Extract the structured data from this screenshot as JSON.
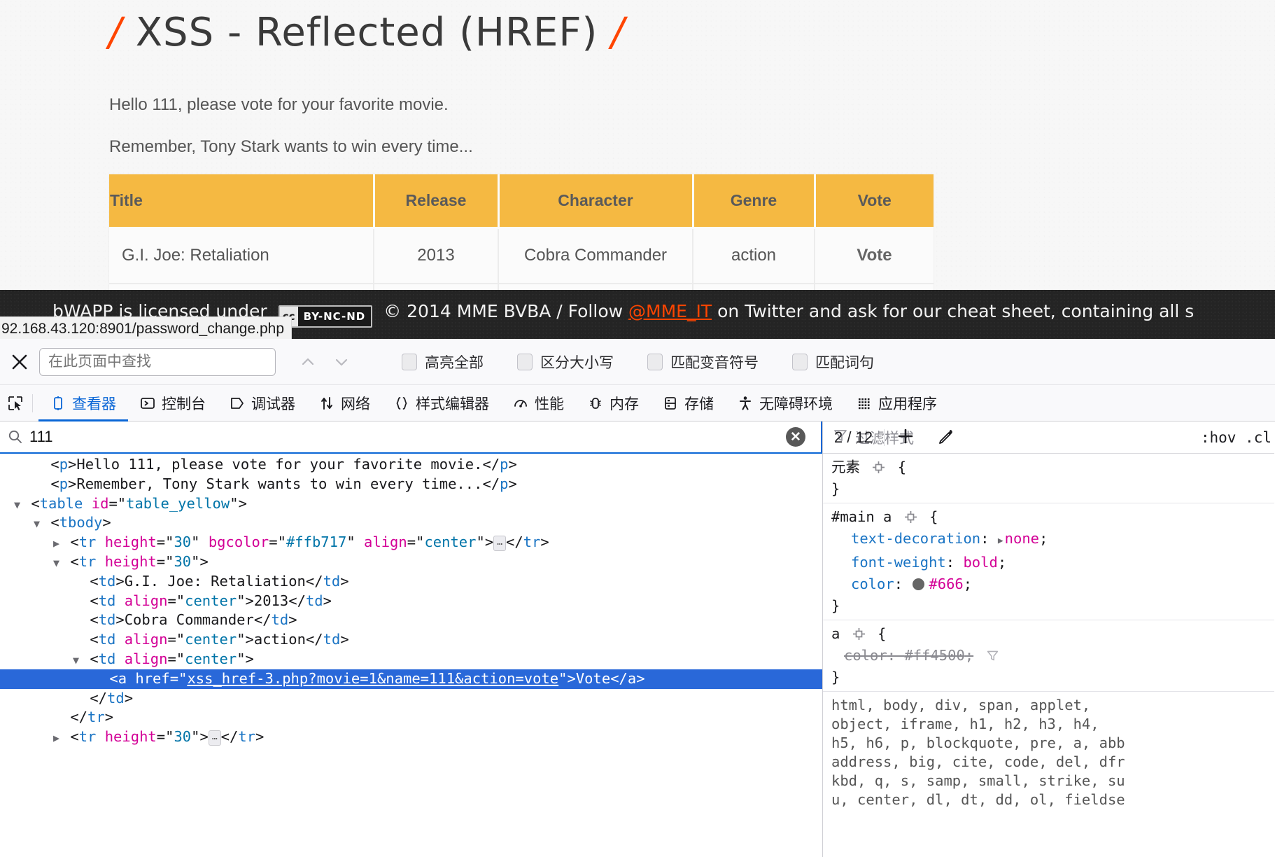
{
  "page": {
    "title_slash_left": "/",
    "title": "XSS - Reflected (HREF)",
    "title_slash_right": "/",
    "para_1": "Hello 111, please vote for your favorite movie.",
    "para_2": "Remember, Tony Stark wants to win every time...",
    "table": {
      "headers": [
        "Title",
        "Release",
        "Character",
        "Genre",
        "Vote"
      ],
      "rows": [
        {
          "title": "G.I. Joe: Retaliation",
          "release": "2013",
          "character": "Cobra Commander",
          "genre": "action",
          "vote": "Vote"
        }
      ]
    },
    "header_bg": "#f5b942"
  },
  "footer": {
    "text_before": "bWAPP is licensed under",
    "cc_mark": "cc",
    "cc_badge": "BY-NC-ND",
    "text_mid": "© 2014 MME BVBA / Follow",
    "twitter_handle": "@MME_IT",
    "text_after": "on Twitter and ask for our cheat sheet, containing all s",
    "link_color": "#ff4500"
  },
  "status_url": "92.168.43.120:8901/password_change.php",
  "find_bar": {
    "close_icon": "close-icon",
    "placeholder": "在此页面中查找",
    "value": "",
    "prev_icon": "chevron-up-icon",
    "next_icon": "chevron-down-icon",
    "checkboxes": [
      {
        "label": "高亮全部",
        "checked": false
      },
      {
        "label": "区分大小写",
        "checked": false
      },
      {
        "label": "匹配变音符号",
        "checked": false
      },
      {
        "label": "匹配词句",
        "checked": false
      }
    ]
  },
  "devtools": {
    "picker_icon": "element-picker-icon",
    "tabs": [
      {
        "label": "查看器",
        "icon": "inspector-icon",
        "active": true
      },
      {
        "label": "控制台",
        "icon": "console-icon",
        "active": false
      },
      {
        "label": "调试器",
        "icon": "debugger-icon",
        "active": false
      },
      {
        "label": "网络",
        "icon": "network-icon",
        "active": false
      },
      {
        "label": "样式编辑器",
        "icon": "style-editor-icon",
        "active": false
      },
      {
        "label": "性能",
        "icon": "performance-icon",
        "active": false
      },
      {
        "label": "内存",
        "icon": "memory-icon",
        "active": false
      },
      {
        "label": "存储",
        "icon": "storage-icon",
        "active": false
      },
      {
        "label": "无障碍环境",
        "icon": "accessibility-icon",
        "active": false
      },
      {
        "label": "应用程序",
        "icon": "application-icon",
        "active": false
      }
    ],
    "search": {
      "icon": "search-icon",
      "value": "111",
      "clear_icon": "clear-icon",
      "match_counter": "2 / 12",
      "add_icon": "plus-icon",
      "eyedropper_icon": "eyedropper-icon"
    },
    "markup": {
      "lines": [
        {
          "indent": 1,
          "twisty": "",
          "segments": [
            {
              "t": "punc",
              "s": "<"
            },
            {
              "t": "tag",
              "s": "p"
            },
            {
              "t": "punc",
              "s": ">"
            },
            {
              "t": "txt",
              "s": "Hello 111, please vote for your favorite movie."
            },
            {
              "t": "punc",
              "s": "</"
            },
            {
              "t": "tag",
              "s": "p"
            },
            {
              "t": "punc",
              "s": ">"
            }
          ]
        },
        {
          "indent": 1,
          "twisty": "",
          "segments": [
            {
              "t": "punc",
              "s": "<"
            },
            {
              "t": "tag",
              "s": "p"
            },
            {
              "t": "punc",
              "s": ">"
            },
            {
              "t": "txt",
              "s": "Remember, Tony Stark wants to win every time..."
            },
            {
              "t": "punc",
              "s": "</"
            },
            {
              "t": "tag",
              "s": "p"
            },
            {
              "t": "punc",
              "s": ">"
            }
          ]
        },
        {
          "indent": 0,
          "twisty": "open",
          "segments": [
            {
              "t": "punc",
              "s": "<"
            },
            {
              "t": "tag",
              "s": "table"
            },
            {
              "t": "txt",
              "s": " "
            },
            {
              "t": "attr",
              "s": "id"
            },
            {
              "t": "punc",
              "s": "=\""
            },
            {
              "t": "val",
              "s": "table_yellow"
            },
            {
              "t": "punc",
              "s": "\">"
            }
          ]
        },
        {
          "indent": 1,
          "twisty": "open",
          "segments": [
            {
              "t": "punc",
              "s": "<"
            },
            {
              "t": "tag",
              "s": "tbody"
            },
            {
              "t": "punc",
              "s": ">"
            }
          ]
        },
        {
          "indent": 2,
          "twisty": "closed",
          "segments": [
            {
              "t": "punc",
              "s": "<"
            },
            {
              "t": "tag",
              "s": "tr"
            },
            {
              "t": "txt",
              "s": " "
            },
            {
              "t": "attr",
              "s": "height"
            },
            {
              "t": "punc",
              "s": "=\""
            },
            {
              "t": "val",
              "s": "30"
            },
            {
              "t": "punc",
              "s": "\" "
            },
            {
              "t": "attr",
              "s": "bgcolor"
            },
            {
              "t": "punc",
              "s": "=\""
            },
            {
              "t": "val",
              "s": "#ffb717"
            },
            {
              "t": "punc",
              "s": "\" "
            },
            {
              "t": "attr",
              "s": "align"
            },
            {
              "t": "punc",
              "s": "=\""
            },
            {
              "t": "val",
              "s": "center"
            },
            {
              "t": "punc",
              "s": "\">"
            },
            {
              "t": "ell",
              "s": "..."
            },
            {
              "t": "punc",
              "s": "</"
            },
            {
              "t": "tag",
              "s": "tr"
            },
            {
              "t": "punc",
              "s": ">"
            }
          ]
        },
        {
          "indent": 2,
          "twisty": "open",
          "segments": [
            {
              "t": "punc",
              "s": "<"
            },
            {
              "t": "tag",
              "s": "tr"
            },
            {
              "t": "txt",
              "s": " "
            },
            {
              "t": "attr",
              "s": "height"
            },
            {
              "t": "punc",
              "s": "=\""
            },
            {
              "t": "val",
              "s": "30"
            },
            {
              "t": "punc",
              "s": "\">"
            }
          ]
        },
        {
          "indent": 3,
          "twisty": "",
          "segments": [
            {
              "t": "punc",
              "s": "<"
            },
            {
              "t": "tag",
              "s": "td"
            },
            {
              "t": "punc",
              "s": ">"
            },
            {
              "t": "txt",
              "s": "G.I. Joe: Retaliation"
            },
            {
              "t": "punc",
              "s": "</"
            },
            {
              "t": "tag",
              "s": "td"
            },
            {
              "t": "punc",
              "s": ">"
            }
          ]
        },
        {
          "indent": 3,
          "twisty": "",
          "segments": [
            {
              "t": "punc",
              "s": "<"
            },
            {
              "t": "tag",
              "s": "td"
            },
            {
              "t": "txt",
              "s": " "
            },
            {
              "t": "attr",
              "s": "align"
            },
            {
              "t": "punc",
              "s": "=\""
            },
            {
              "t": "val",
              "s": "center"
            },
            {
              "t": "punc",
              "s": "\">"
            },
            {
              "t": "txt",
              "s": "2013"
            },
            {
              "t": "punc",
              "s": "</"
            },
            {
              "t": "tag",
              "s": "td"
            },
            {
              "t": "punc",
              "s": ">"
            }
          ]
        },
        {
          "indent": 3,
          "twisty": "",
          "segments": [
            {
              "t": "punc",
              "s": "<"
            },
            {
              "t": "tag",
              "s": "td"
            },
            {
              "t": "punc",
              "s": ">"
            },
            {
              "t": "txt",
              "s": "Cobra Commander"
            },
            {
              "t": "punc",
              "s": "</"
            },
            {
              "t": "tag",
              "s": "td"
            },
            {
              "t": "punc",
              "s": ">"
            }
          ]
        },
        {
          "indent": 3,
          "twisty": "",
          "segments": [
            {
              "t": "punc",
              "s": "<"
            },
            {
              "t": "tag",
              "s": "td"
            },
            {
              "t": "txt",
              "s": " "
            },
            {
              "t": "attr",
              "s": "align"
            },
            {
              "t": "punc",
              "s": "=\""
            },
            {
              "t": "val",
              "s": "center"
            },
            {
              "t": "punc",
              "s": "\">"
            },
            {
              "t": "txt",
              "s": "action"
            },
            {
              "t": "punc",
              "s": "</"
            },
            {
              "t": "tag",
              "s": "td"
            },
            {
              "t": "punc",
              "s": ">"
            }
          ]
        },
        {
          "indent": 3,
          "twisty": "open",
          "segments": [
            {
              "t": "punc",
              "s": "<"
            },
            {
              "t": "tag",
              "s": "td"
            },
            {
              "t": "txt",
              "s": " "
            },
            {
              "t": "attr",
              "s": "align"
            },
            {
              "t": "punc",
              "s": "=\""
            },
            {
              "t": "val",
              "s": "center"
            },
            {
              "t": "punc",
              "s": "\">"
            }
          ]
        },
        {
          "indent": 4,
          "twisty": "",
          "selected": true,
          "segments": [
            {
              "t": "punc",
              "s": "<"
            },
            {
              "t": "tag",
              "s": "a"
            },
            {
              "t": "txt",
              "s": " "
            },
            {
              "t": "attr",
              "s": "href"
            },
            {
              "t": "punc",
              "s": "=\""
            },
            {
              "t": "val",
              "s": "xss_href-3.php?movie=1&name=111&action=vote"
            },
            {
              "t": "punc",
              "s": "\">"
            },
            {
              "t": "txt",
              "s": "Vote"
            },
            {
              "t": "punc",
              "s": "</"
            },
            {
              "t": "tag",
              "s": "a"
            },
            {
              "t": "punc",
              "s": ">"
            }
          ]
        },
        {
          "indent": 3,
          "twisty": "",
          "segments": [
            {
              "t": "punc",
              "s": "</"
            },
            {
              "t": "tag",
              "s": "td"
            },
            {
              "t": "punc",
              "s": ">"
            }
          ]
        },
        {
          "indent": 2,
          "twisty": "",
          "segments": [
            {
              "t": "punc",
              "s": "</"
            },
            {
              "t": "tag",
              "s": "tr"
            },
            {
              "t": "punc",
              "s": ">"
            }
          ]
        },
        {
          "indent": 2,
          "twisty": "closed",
          "segments": [
            {
              "t": "punc",
              "s": "<"
            },
            {
              "t": "tag",
              "s": "tr"
            },
            {
              "t": "txt",
              "s": " "
            },
            {
              "t": "attr",
              "s": "height"
            },
            {
              "t": "punc",
              "s": "=\""
            },
            {
              "t": "val",
              "s": "30"
            },
            {
              "t": "punc",
              "s": "\">"
            },
            {
              "t": "ell",
              "s": "..."
            },
            {
              "t": "punc",
              "s": "</"
            },
            {
              "t": "tag",
              "s": "tr"
            },
            {
              "t": "punc",
              "s": ">"
            }
          ]
        }
      ]
    },
    "rules": {
      "filter_placeholder": "过滤样式",
      "filter_icon": "filter-icon",
      "pseudo": ":hov  .cl",
      "blocks": [
        {
          "selector": "元素",
          "declarations": []
        },
        {
          "selector": "#main a",
          "declarations": [
            {
              "prop": "text-decoration",
              "value": "none",
              "expandable": true,
              "struck": false
            },
            {
              "prop": "font-weight",
              "value": "bold",
              "expandable": false,
              "struck": false
            },
            {
              "prop": "color",
              "value": "#666",
              "swatch": "#666666",
              "expandable": false,
              "struck": false
            }
          ]
        },
        {
          "selector": "a",
          "declarations": [
            {
              "prop": "color",
              "value": "#ff4500",
              "struck": true,
              "filter_icon": true
            }
          ]
        }
      ],
      "ua_rule_text": "html, body, div, span, applet,\nobject, iframe, h1, h2, h3, h4,\nh5, h6, p, blockquote, pre, a, abb\naddress, big, cite, code, del, dfr\nkbd, q, s, samp, small, strike, su\nu, center, dl, dt, dd, ol, fieldse"
    }
  }
}
